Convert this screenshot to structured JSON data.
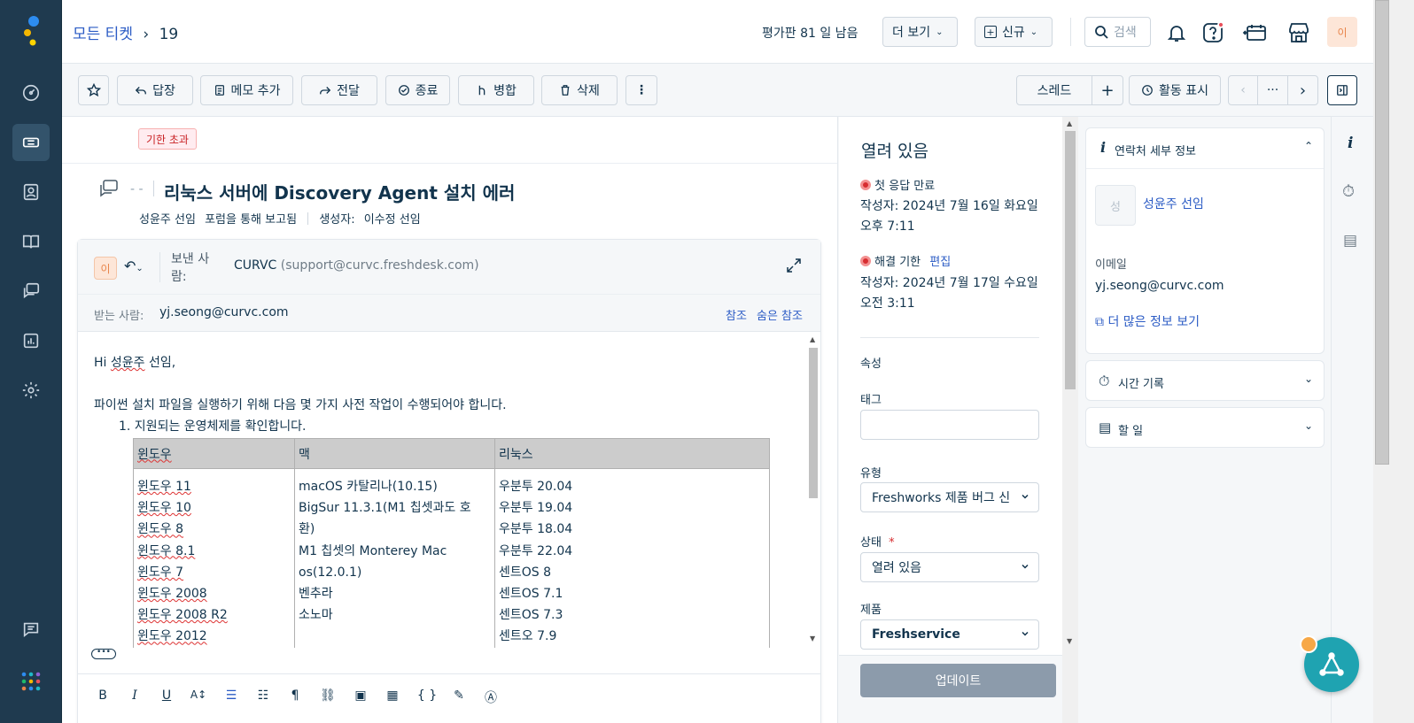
{
  "breadcrumb": {
    "root": "모든 티켓",
    "separator": "›",
    "current": "19"
  },
  "topbar": {
    "trial": "평가판 81 일 남음",
    "more_label": "더 보기",
    "new_label": "신규",
    "search_label": "검색",
    "avatar_initial": "이"
  },
  "toolbar": {
    "reply": "답장",
    "add_note": "메모 추가",
    "forward": "전달",
    "close": "종료",
    "merge": "병합",
    "delete": "삭제",
    "thread": "스레드",
    "show_activity": "활동 표시"
  },
  "ticket": {
    "overdue_badge": "기한 초과",
    "title_prefix": "- -",
    "title": "리눅스 서버에 Discovery Agent 설치 에러",
    "reporter": "성윤주 선임",
    "via": "포럼을 통해 보고됨",
    "creator_label": "생성자:",
    "creator": "이수정 선임"
  },
  "email": {
    "avatar_initial": "이",
    "from_label": "보낸 사람:",
    "from_name": "CURVC",
    "from_address": "(support@curvc.freshdesk.com)",
    "to_label": "받는 사람:",
    "to_address": "yj.seong@curvc.com",
    "cc_label": "참조",
    "bcc_label": "숨은 참조",
    "greeting_prefix": "Hi ",
    "greeting_name": "성윤주",
    "greeting_suffix": " 선임,",
    "intro": "파이썬 설치 파일을 실행하기 위해 다음 몇 가지 사전 작업이 수행되어야 합니다.",
    "step1": "1. 지원되는 운영체제를 확인합니다.",
    "table": {
      "headers": [
        "윈도우",
        "맥",
        "리눅스"
      ],
      "windows": [
        "윈도우 11",
        "윈도우 10",
        "윈도우 8",
        "윈도우 8.1",
        "윈도우 7",
        "윈도우 2008",
        "윈도우 2008 R2",
        "윈도우 2012"
      ],
      "mac": [
        "macOS 카탈리나(10.15)",
        "BigSur 11.3.1(M1 칩셋과도 호",
        "환)",
        "M1 칩셋의 Monterey Mac",
        "os(12.0.1)",
        "벤추라",
        "소노마"
      ],
      "linux": [
        "우분투 20.04",
        "우분투 19.04",
        "우분투 18.04",
        "우분투 22.04",
        "센트OS 8",
        "센트OS 7.1",
        "센트OS 7.3",
        "센트오 7.9"
      ]
    }
  },
  "properties": {
    "status_title": "열려 있음",
    "first_response_label": "첫 응답 만료",
    "first_response_date": "작성자: 2024년 7월 16일 화요일 오후 7:11",
    "resolution_label": "해결 기한",
    "edit_label": "편집",
    "resolution_date": "작성자: 2024년 7월 17일 수요일 오전 3:11",
    "section": "속성",
    "tags_label": "태그",
    "type_label": "유형",
    "type_value": "Freshworks 제품 버그 신",
    "state_label": "상태",
    "required_mark": "*",
    "state_value": "열려 있음",
    "product_label": "제품",
    "product_value": "Freshservice",
    "update_button": "업데이트"
  },
  "contact": {
    "header": "연락처 세부 정보",
    "avatar_initial": "성",
    "name": "성윤주 선임",
    "email_label": "이메일",
    "email": "yj.seong@curvc.com",
    "more_info": "더 많은 정보 보기",
    "time_log": "시간 기록",
    "todo": "할 일"
  },
  "colors": {
    "nav_bg": "#1f3a4f",
    "link": "#2c5cc5",
    "overdue": "#c82124",
    "update_btn": "#8c9bab",
    "fab": "#1fa3b1"
  }
}
